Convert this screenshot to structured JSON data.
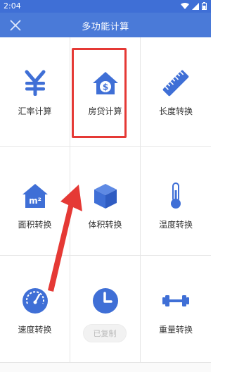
{
  "status": {
    "time": "2:04"
  },
  "appbar": {
    "title": "多功能计算"
  },
  "tiles": [
    {
      "label": "汇率计算",
      "icon": "yen-icon"
    },
    {
      "label": "房贷计算",
      "icon": "house-dollar-icon"
    },
    {
      "label": "长度转换",
      "icon": "ruler-icon"
    },
    {
      "label": "面积转换",
      "icon": "area-m2-icon"
    },
    {
      "label": "体积转换",
      "icon": "cube-icon"
    },
    {
      "label": "温度转换",
      "icon": "thermometer-icon"
    },
    {
      "label": "速度转换",
      "icon": "speedometer-icon"
    },
    {
      "label": "",
      "icon": "clock-icon"
    },
    {
      "label": "重量转换",
      "icon": "dumbbell-icon"
    }
  ],
  "toast": {
    "text": "已复制"
  },
  "area_icon_text": "m²",
  "colors": {
    "accent": "#4a7ad8",
    "icon": "#3f6fd6",
    "annotation": "#e53935"
  }
}
